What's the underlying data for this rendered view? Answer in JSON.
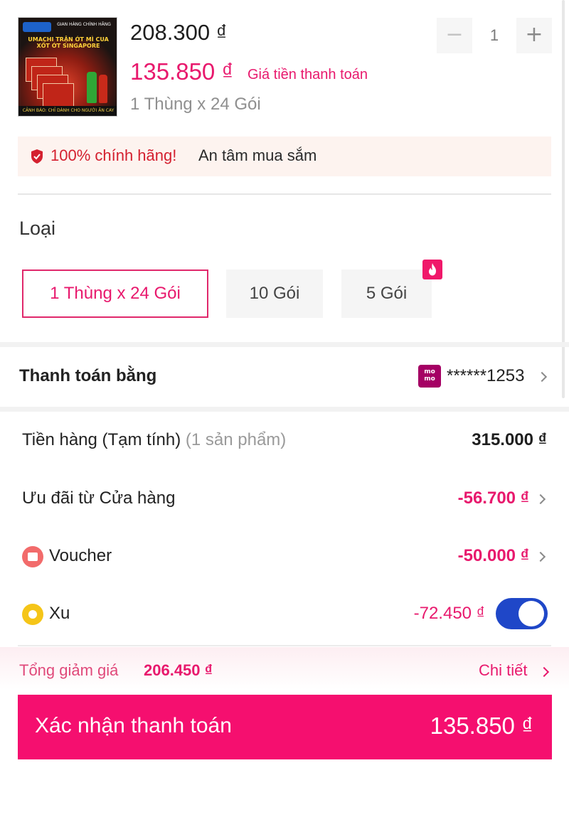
{
  "product": {
    "image_alt": "Umachi Trận Ớt – Mì cua xốt ớt Singapore",
    "image_lines": {
      "store": "GIAN HÀNG CHÍNH HÃNG",
      "headline": "UMACHI TRẬN ỚT MÌ CUA XỐT ỚT SINGAPORE",
      "warning": "CẢNH BÁO: CHỈ DÀNH CHO NGƯỜI ĂN CAY"
    },
    "original_price": "208.300 ₫",
    "pay_price": "135.850 ₫",
    "pay_price_label": "Giá tiền thanh toán",
    "variant": "1 Thùng x 24 Gói",
    "quantity": "1",
    "minus": "−",
    "plus": "+"
  },
  "genuine": {
    "highlight": "100% chính hãng!",
    "text": "An tâm mua sắm"
  },
  "type_section": {
    "title": "Loại",
    "options": [
      {
        "label": "1 Thùng x 24 Gói",
        "selected": true
      },
      {
        "label": "10 Gói",
        "selected": false
      },
      {
        "label": "5 Gói",
        "selected": false,
        "hot_badge": true
      }
    ]
  },
  "payment": {
    "label": "Thanh toán bằng",
    "method_icon": "momo-icon",
    "method_text": "mo mo",
    "account": "******1253"
  },
  "summary": {
    "subtotal_label": "Tiền hàng (Tạm tính)",
    "subtotal_count": "(1 sản phẩm)",
    "subtotal_value": "315.000 ₫",
    "shop_discount_label": "Ưu đãi từ Cửa hàng",
    "shop_discount_value": "-56.700 ₫",
    "voucher_label": "Voucher",
    "voucher_value": "-50.000 ₫",
    "xu_label": "Xu",
    "xu_value": "-72.450 ₫",
    "xu_enabled": true
  },
  "footer": {
    "total_discount_label": "Tổng giảm giá",
    "total_discount_value": "206.450 ₫",
    "detail_label": "Chi tiết",
    "confirm_label": "Xác nhận thanh toán",
    "confirm_amount": "135.850 ₫"
  },
  "colors": {
    "accent": "#e8196d",
    "cta": "#f50f6f",
    "toggle": "#1f47c8",
    "momo": "#a50064"
  }
}
